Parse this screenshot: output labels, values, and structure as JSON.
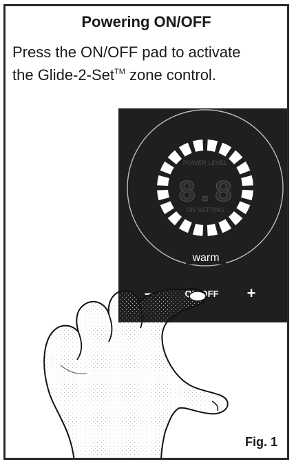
{
  "title": "Powering ON/OFF",
  "instruction": {
    "line1": "Press the ON/OFF pad to activate",
    "line2_prefix": "the Glide-2-Set",
    "trademark": "TM",
    "line2_suffix": " zone control."
  },
  "control_panel": {
    "display_digits": "8.8",
    "display_top_caption": "POWER LEVEL",
    "display_bottom_caption": "ON SETTING",
    "zone_label": "warm",
    "minus_label": "–",
    "onoff_label": "ON/OFF",
    "plus_label": "+"
  },
  "figure_label": "Fig. 1",
  "colors": {
    "panel": "#1f1f1f",
    "segment": "#ffffff",
    "ring": "#bdbdbd"
  },
  "icons": [
    "hand-illustration"
  ]
}
